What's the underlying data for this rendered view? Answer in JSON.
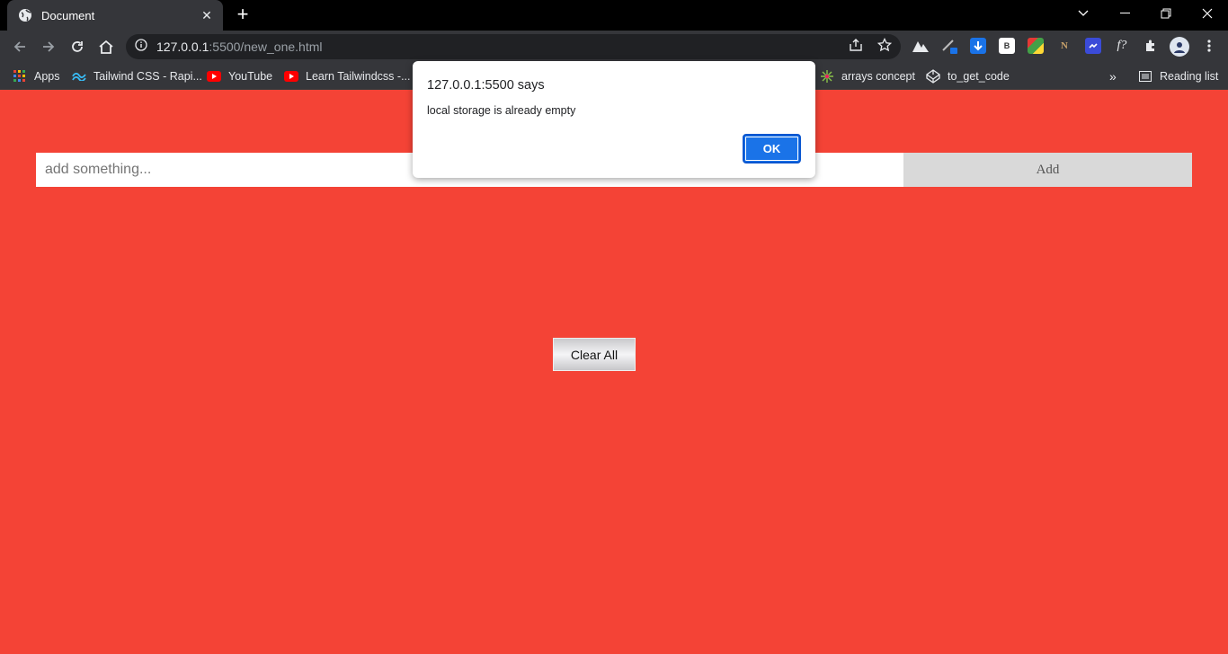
{
  "browser": {
    "tab_title": "Document",
    "url_host": "127.0.0.1",
    "url_rest": ":5500/new_one.html",
    "bookmarks": [
      {
        "label": "Apps",
        "icon": "apps-grid-icon"
      },
      {
        "label": "Tailwind CSS - Rapi...",
        "icon": "tailwind-icon"
      },
      {
        "label": "YouTube",
        "icon": "youtube-icon"
      },
      {
        "label": "Learn Tailwindcss -...",
        "icon": "youtube-icon"
      },
      {
        "label": "arrays concept",
        "icon": "sparkle-icon"
      },
      {
        "label": "to_get_code",
        "icon": "codepen-icon"
      }
    ],
    "reading_list": "Reading list",
    "more_bookmarks": "»"
  },
  "page": {
    "input_placeholder": "add something...",
    "add_label": "Add",
    "clear_label": "Clear All",
    "background_color": "#f44336"
  },
  "dialog": {
    "heading": "127.0.0.1:5500 says",
    "message": "local storage is already empty",
    "ok_label": "OK"
  }
}
